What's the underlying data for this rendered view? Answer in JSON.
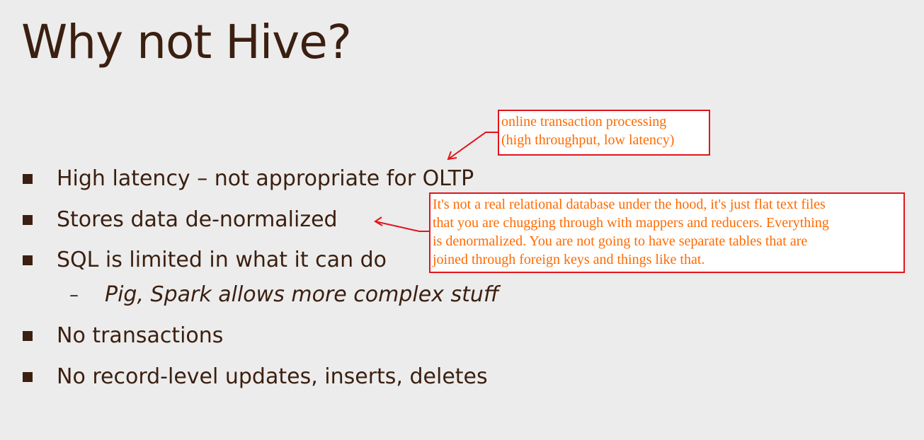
{
  "slide": {
    "title": "Why not Hive?"
  },
  "bullets": [
    {
      "text": "High latency – not appropriate for OLTP"
    },
    {
      "text": "Stores data de-normalized"
    },
    {
      "text": "SQL is limited in what it can do"
    },
    {
      "text": "No transactions"
    },
    {
      "text": "No record-level updates, inserts, deletes"
    }
  ],
  "sub_bullet": {
    "dash": "–",
    "text": "Pig, Spark allows more complex stuff"
  },
  "annotations": {
    "oltp_note": {
      "lines": [
        "online transaction processing",
        "(high throughput, low latency)"
      ]
    },
    "denorm_note": {
      "lines": [
        "It's not a real relational database under the hood, it's just flat text files",
        "that you are chugging through with mappers and reducers. Everything",
        "is denormalized. You are not going to have separate tables that are",
        "joined through foreign keys and things like that."
      ]
    }
  },
  "colors": {
    "background": "#ececec",
    "text": "#3b1f10",
    "annotation_border": "#e3141c",
    "annotation_text": "#ff6a00"
  }
}
